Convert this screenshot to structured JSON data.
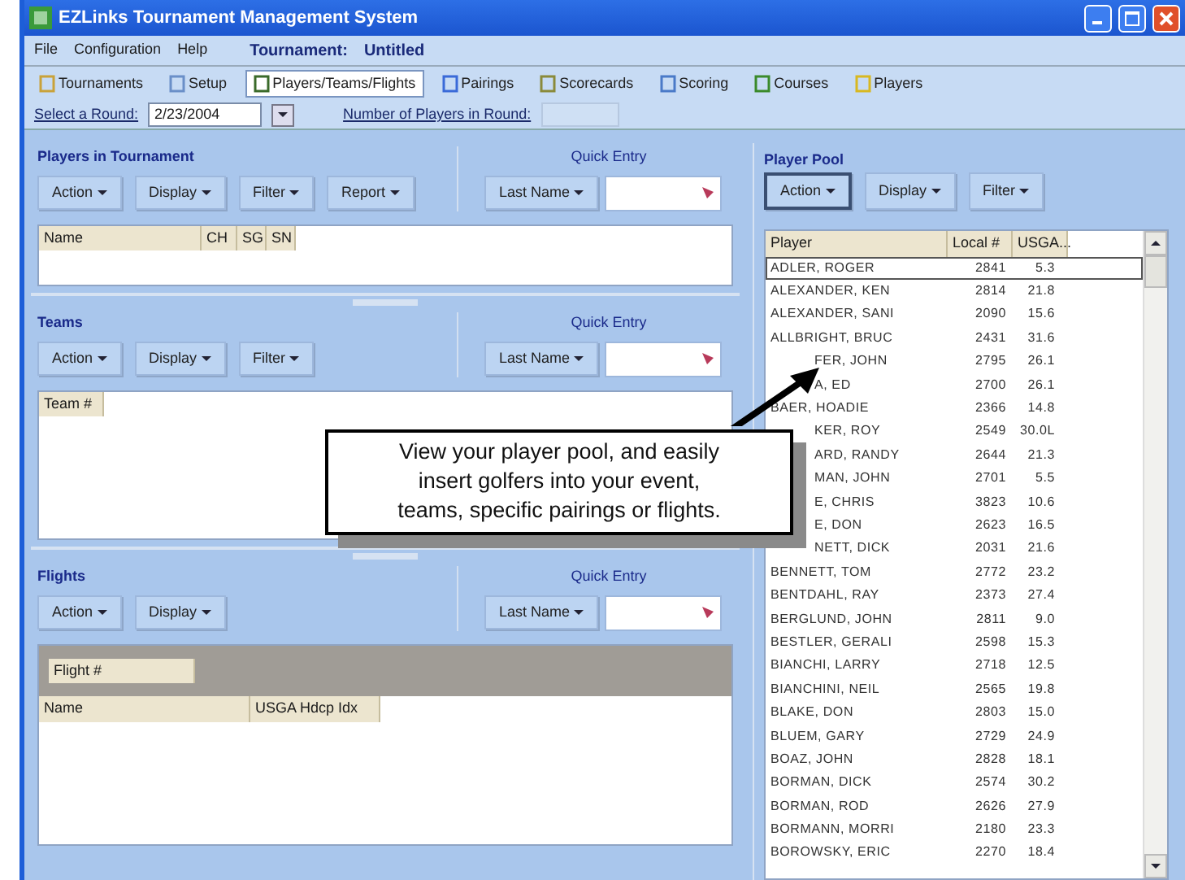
{
  "window": {
    "title": "EZLinks Tournament Management System"
  },
  "menu": [
    "File",
    "Configuration",
    "Help"
  ],
  "tournament": {
    "label": "Tournament:",
    "name": "Untitled"
  },
  "toolbar": [
    {
      "label": "Tournaments",
      "selected": false
    },
    {
      "label": "Setup",
      "selected": false
    },
    {
      "label": "Players/Teams/Flights",
      "selected": true
    },
    {
      "label": "Pairings",
      "selected": false
    },
    {
      "label": "Scorecards",
      "selected": false
    },
    {
      "label": "Scoring",
      "selected": false
    },
    {
      "label": "Courses",
      "selected": false
    },
    {
      "label": "Players",
      "selected": false
    }
  ],
  "round": {
    "label": "Select a Round:",
    "value": "2/23/2004",
    "players_label": "Number of Players in Round:"
  },
  "sections": [
    {
      "title": "Players in Tournament",
      "buttons": [
        "Action",
        "Display",
        "Filter",
        "Report"
      ],
      "quick_entry": "Quick Entry",
      "quick_button": "Last Name",
      "columns": [
        "Name",
        "CH",
        "SG",
        "SN"
      ]
    },
    {
      "title": "Teams",
      "buttons": [
        "Action",
        "Display",
        "Filter"
      ],
      "quick_entry": "Quick Entry",
      "quick_button": "Last Name",
      "columns": [
        "Team #"
      ]
    },
    {
      "title": "Flights",
      "buttons": [
        "Action",
        "Display"
      ],
      "quick_entry": "Quick Entry",
      "quick_button": "Last Name",
      "group_header": "Flight #",
      "columns": [
        "Name",
        "USGA Hdcp Idx"
      ]
    }
  ],
  "player_pool": {
    "title": "Player Pool",
    "buttons": [
      {
        "label": "Action",
        "selected": true
      },
      {
        "label": "Display",
        "selected": false
      },
      {
        "label": "Filter",
        "selected": false
      }
    ],
    "columns": [
      "Player",
      "Local #",
      "USGA..."
    ],
    "rows": [
      {
        "player": "ADLER, ROGER",
        "local": "2841",
        "usga": "5.3",
        "selected": true,
        "covered": false
      },
      {
        "player": "ALEXANDER, KEN",
        "local": "2814",
        "usga": "21.8",
        "selected": false,
        "covered": false
      },
      {
        "player": "ALEXANDER, SANI",
        "local": "2090",
        "usga": "15.6",
        "selected": false,
        "covered": false
      },
      {
        "player": "ALLBRIGHT, BRUC",
        "local": "2431",
        "usga": "31.6",
        "selected": false,
        "covered": false
      },
      {
        "player": "FER, JOHN",
        "local": "2795",
        "usga": "26.1",
        "selected": false,
        "covered": true
      },
      {
        "player": "A, ED",
        "local": "2700",
        "usga": "26.1",
        "selected": false,
        "covered": true
      },
      {
        "player": "BAER, HOADIE",
        "local": "2366",
        "usga": "14.8",
        "selected": false,
        "covered": false
      },
      {
        "player": "KER, ROY",
        "local": "2549",
        "usga": "30.0L",
        "selected": false,
        "covered": true
      },
      {
        "player": "ARD, RANDY",
        "local": "2644",
        "usga": "21.3",
        "selected": false,
        "covered": true
      },
      {
        "player": "MAN, JOHN",
        "local": "2701",
        "usga": "5.5",
        "selected": false,
        "covered": true
      },
      {
        "player": "E, CHRIS",
        "local": "3823",
        "usga": "10.6",
        "selected": false,
        "covered": true
      },
      {
        "player": "E, DON",
        "local": "2623",
        "usga": "16.5",
        "selected": false,
        "covered": true
      },
      {
        "player": "NETT, DICK",
        "local": "2031",
        "usga": "21.6",
        "selected": false,
        "covered": true
      },
      {
        "player": "BENNETT, TOM",
        "local": "2772",
        "usga": "23.2",
        "selected": false,
        "covered": false
      },
      {
        "player": "BENTDAHL, RAY",
        "local": "2373",
        "usga": "27.4",
        "selected": false,
        "covered": false
      },
      {
        "player": "BERGLUND, JOHN",
        "local": "2811",
        "usga": "9.0",
        "selected": false,
        "covered": false
      },
      {
        "player": "BESTLER, GERALI",
        "local": "2598",
        "usga": "15.3",
        "selected": false,
        "covered": false
      },
      {
        "player": "BIANCHI, LARRY",
        "local": "2718",
        "usga": "12.5",
        "selected": false,
        "covered": false
      },
      {
        "player": "BIANCHINI, NEIL",
        "local": "2565",
        "usga": "19.8",
        "selected": false,
        "covered": false
      },
      {
        "player": "BLAKE, DON",
        "local": "2803",
        "usga": "15.0",
        "selected": false,
        "covered": false
      },
      {
        "player": "BLUEM, GARY",
        "local": "2729",
        "usga": "24.9",
        "selected": false,
        "covered": false
      },
      {
        "player": "BOAZ, JOHN",
        "local": "2828",
        "usga": "18.1",
        "selected": false,
        "covered": false
      },
      {
        "player": "BORMAN, DICK",
        "local": "2574",
        "usga": "30.2",
        "selected": false,
        "covered": false
      },
      {
        "player": "BORMAN, ROD",
        "local": "2626",
        "usga": "27.9",
        "selected": false,
        "covered": false
      },
      {
        "player": "BORMANN, MORRI",
        "local": "2180",
        "usga": "23.3",
        "selected": false,
        "covered": false
      },
      {
        "player": "BOROWSKY, ERIC",
        "local": "2270",
        "usga": "18.4",
        "selected": false,
        "covered": false
      }
    ]
  },
  "callout": {
    "lines": [
      "View your player pool, and easily",
      "insert golfers into your event,",
      "teams, specific pairings or flights."
    ]
  }
}
